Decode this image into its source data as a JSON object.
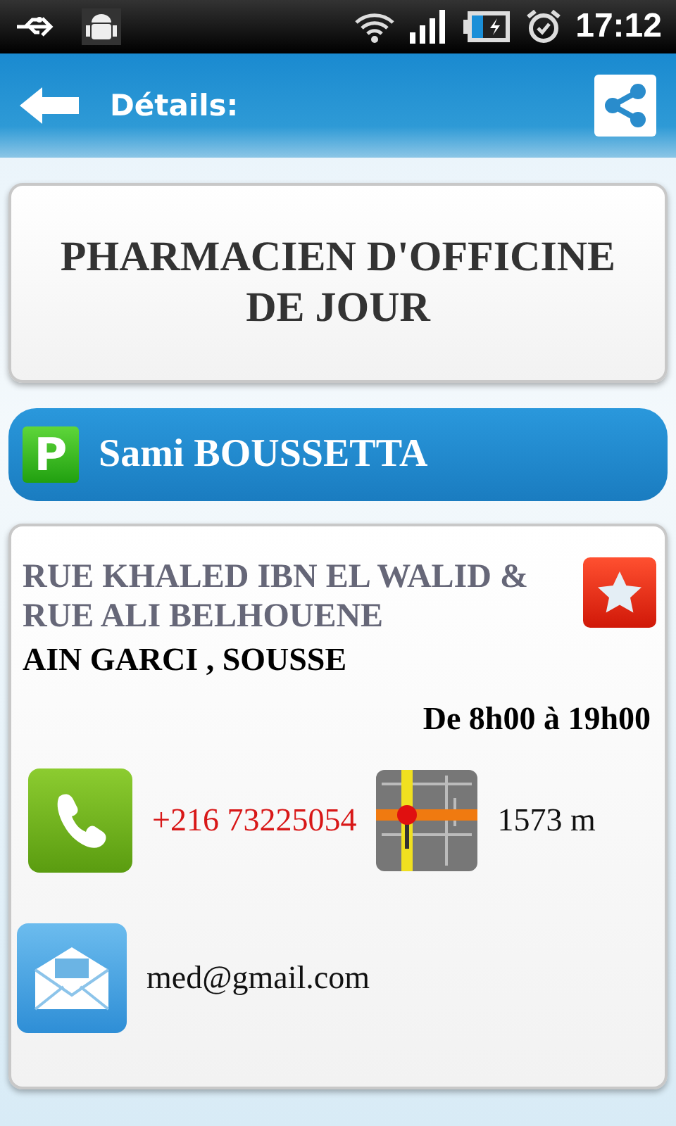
{
  "status_bar": {
    "time": "17:12"
  },
  "header": {
    "title": "Détails:"
  },
  "title_card": {
    "title": "PHARMACIEN D'OFFICINE DE JOUR"
  },
  "name_bar": {
    "badge": "P",
    "name": "Sami BOUSSETTA"
  },
  "details": {
    "address": "RUE KHALED IBN EL WALID & RUE ALI BELHOUENE",
    "city": "AIN GARCI , SOUSSE",
    "hours": "De 8h00 à 19h00",
    "phone": "+216 73225054",
    "distance": "1573 m",
    "email": "med@gmail.com"
  }
}
